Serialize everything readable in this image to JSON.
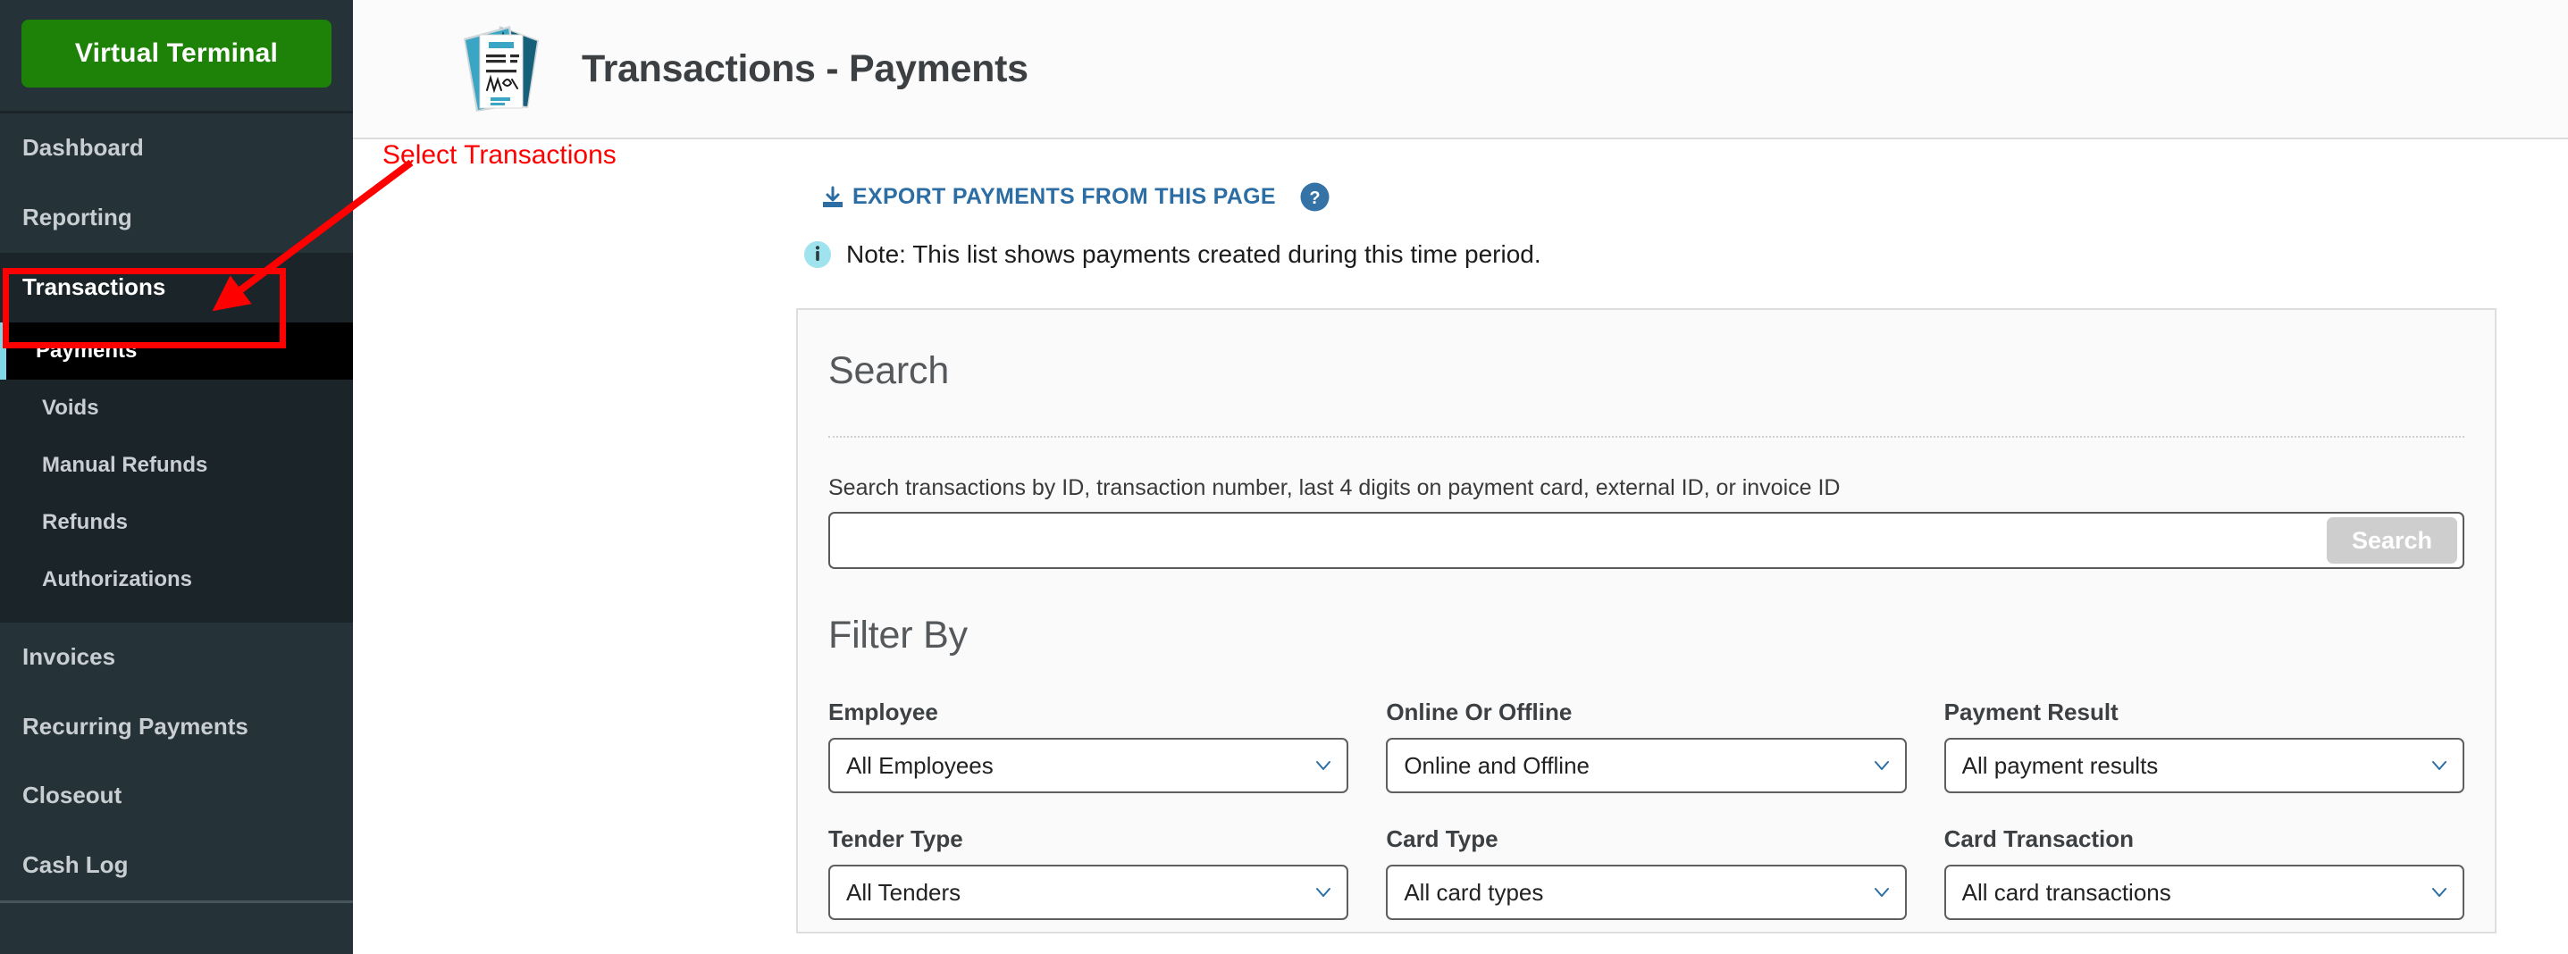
{
  "sidebar": {
    "virtual_terminal_button": "Virtual Terminal",
    "items": [
      {
        "label": "Dashboard",
        "active": false
      },
      {
        "label": "Reporting",
        "active": false
      },
      {
        "label": "Transactions",
        "active": true
      }
    ],
    "sub_items": [
      {
        "label": "Payments",
        "active": true
      },
      {
        "label": "Voids",
        "active": false
      },
      {
        "label": "Manual Refunds",
        "active": false
      },
      {
        "label": "Refunds",
        "active": false
      },
      {
        "label": "Authorizations",
        "active": false
      }
    ],
    "items_after": [
      {
        "label": "Invoices"
      },
      {
        "label": "Recurring Payments"
      },
      {
        "label": "Closeout"
      },
      {
        "label": "Cash Log"
      }
    ],
    "accent_active": "#7fd8e8",
    "vt_button_color": "#1e8208"
  },
  "header": {
    "title": "Transactions - Payments",
    "icon": "document-signature-icon"
  },
  "toolbar": {
    "export_label": "EXPORT PAYMENTS FROM THIS PAGE",
    "export_icon": "download-icon",
    "help_icon": "help-circle-icon",
    "link_color": "#2c6da4"
  },
  "note": {
    "icon": "info-circle-icon",
    "text": "Note: This list shows payments created during this time period."
  },
  "search": {
    "section_title": "Search",
    "field_label": "Search transactions by ID, transaction number, last 4 digits on payment card, external ID, or invoice ID",
    "input_value": "",
    "input_placeholder": "",
    "button_label": "Search"
  },
  "filters": {
    "section_title": "Filter By",
    "fields": [
      {
        "label": "Employee",
        "value": "All Employees"
      },
      {
        "label": "Online Or Offline",
        "value": "Online and Offline"
      },
      {
        "label": "Payment Result",
        "value": "All payment results"
      },
      {
        "label": "Tender Type",
        "value": "All Tenders"
      },
      {
        "label": "Card Type",
        "value": "All card types"
      },
      {
        "label": "Card Transaction",
        "value": "All card transactions"
      }
    ]
  },
  "annotations": {
    "label": "Select Transactions",
    "color": "#ff0000",
    "highlight_target": "sidebar-item-transactions"
  }
}
